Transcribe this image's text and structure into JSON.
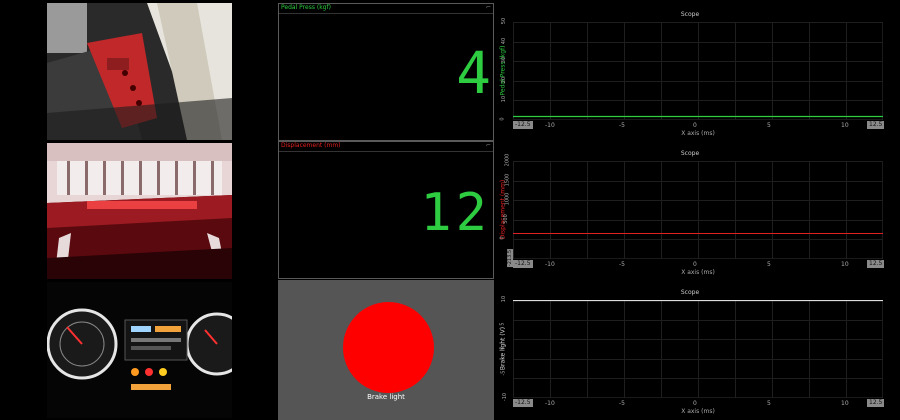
{
  "panels": {
    "pedal": {
      "title": "Pedal Press (kgf)",
      "value": "4",
      "corner": "⌐",
      "title_color": "#2ecc40",
      "value_color": "#2ecc40"
    },
    "displacement": {
      "title": "Displacement (mm)",
      "value": "12",
      "corner": "⌐",
      "title_color": "#e02020",
      "value_color": "#2ecc40"
    },
    "brake": {
      "label": "Brake light",
      "light_color": "#ff0000"
    }
  },
  "scopes": [
    {
      "title": "Scope",
      "ylabel": "Pedal Press (kgf)",
      "ylabel_color": "#2ecc40",
      "yticks": [
        "50",
        "40",
        "30",
        "20",
        "10",
        "0"
      ],
      "xticks": [
        "-10",
        "-5",
        "0",
        "5",
        "10"
      ],
      "xmin": "-12.5",
      "xmax": "12.5",
      "xlabel": "X axis (ms)",
      "trace_color": "#2ecc40"
    },
    {
      "title": "Scope",
      "ylabel": "Displacement (mm)",
      "ylabel_color": "#e02020",
      "yticks": [
        "2000",
        "1500",
        "1000",
        "500",
        "0",
        "-213.5"
      ],
      "xticks": [
        "-10",
        "-5",
        "0",
        "5",
        "10"
      ],
      "xmin": "-12.5",
      "xmax": "12.5",
      "xlabel": "X axis (ms)",
      "trace_color": "#e02020"
    },
    {
      "title": "Scope",
      "ylabel": "Brake light (V)",
      "ylabel_color": "#dddddd",
      "yticks": [
        "10",
        "5",
        "0",
        "-5",
        "-10"
      ],
      "xticks": [
        "-10",
        "-5",
        "0",
        "5",
        "10"
      ],
      "xmin": "-12.5",
      "xmax": "12.5",
      "xlabel": "X axis (ms)",
      "trace_color": "#dddddd"
    }
  ]
}
